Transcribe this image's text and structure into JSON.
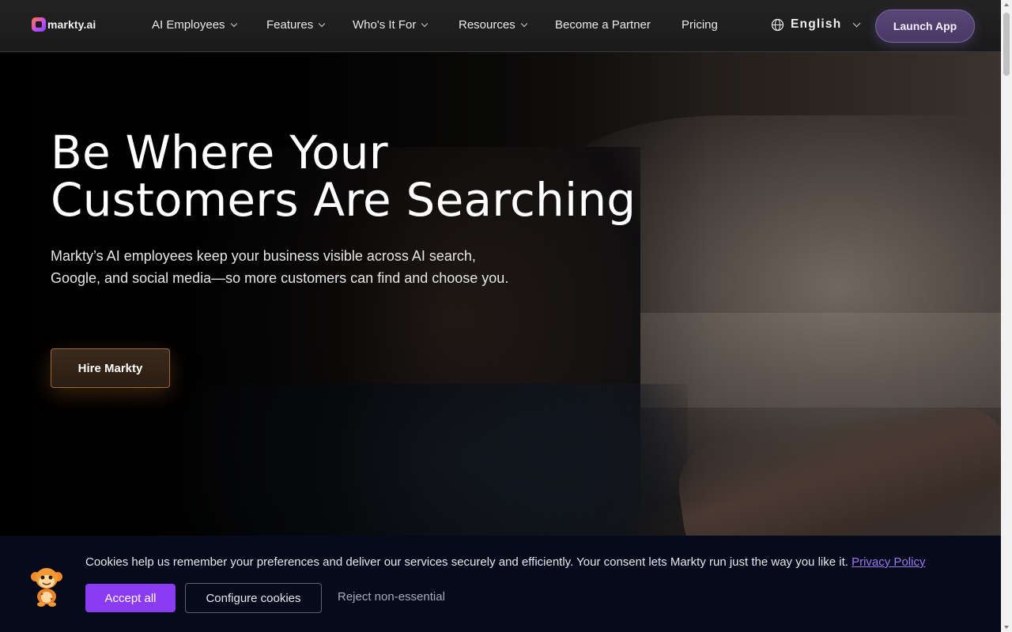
{
  "brand": {
    "logo_text": "markty.ai"
  },
  "nav": {
    "items": [
      {
        "label": "AI Employees",
        "has_dropdown": true
      },
      {
        "label": "Features",
        "has_dropdown": true
      },
      {
        "label": "Who's It For",
        "has_dropdown": true
      },
      {
        "label": "Resources",
        "has_dropdown": true
      },
      {
        "label": "Become a Partner",
        "has_dropdown": false
      },
      {
        "label": "Pricing",
        "has_dropdown": false
      }
    ],
    "language": "English",
    "language_icon": "globe-icon",
    "launch_label": "Launch App"
  },
  "hero": {
    "title_line1": "Be Where Your",
    "title_line2": "Customers Are Searching",
    "subtitle": "Markty’s AI employees keep your business visible across AI search, Google, and social media—so more customers can find and choose you.",
    "cta_label": "Hire Markty"
  },
  "cookie_banner": {
    "message": "Cookies help us remember your preferences and deliver our services securely and efficiently. Your consent lets Markty run just the way you like it.",
    "policy_link": "Privacy Policy",
    "accept_label": "Accept all",
    "configure_label": "Configure cookies",
    "reject_label": "Reject non-essential",
    "mascot_icon": "mascot-icon"
  },
  "colors": {
    "accent_purple": "#8b3cf3",
    "launch_button": "#4f3c6d",
    "hire_button_border": "#9a6a3c",
    "cookie_bg": "#060a1a",
    "link": "#9a7bf0"
  }
}
